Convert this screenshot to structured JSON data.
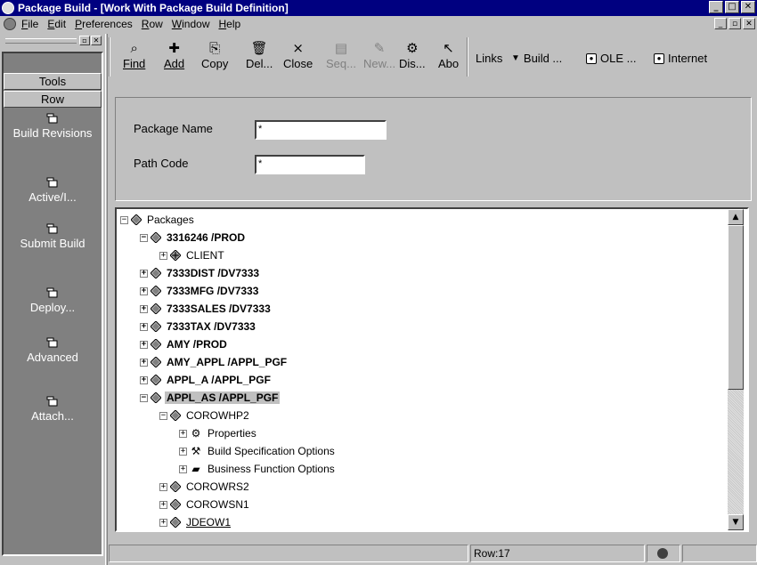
{
  "window": {
    "title": "Package Build - [Work With Package Build Definition]"
  },
  "menu": [
    {
      "label": "File",
      "u": "F",
      "rest": "ile"
    },
    {
      "label": "Edit",
      "u": "E",
      "rest": "dit"
    },
    {
      "label": "Preferences",
      "u": "P",
      "rest": "references"
    },
    {
      "label": "Row",
      "u": "R",
      "rest": "ow"
    },
    {
      "label": "Window",
      "u": "W",
      "rest": "indow"
    },
    {
      "label": "Help",
      "u": "H",
      "rest": "elp"
    }
  ],
  "sidebar": {
    "tabs": [
      "Tools",
      "Row"
    ],
    "items": [
      {
        "label": "Build Revisions"
      },
      {
        "label": "Active/I..."
      },
      {
        "label": "Submit Build"
      },
      {
        "label": "Deploy..."
      },
      {
        "label": "Advanced"
      },
      {
        "label": "Attach..."
      }
    ]
  },
  "toolbar": {
    "find": "Find",
    "add": "Add",
    "copy": "Copy",
    "delete": "Del...",
    "close": "Close",
    "seq": "Seq...",
    "new": "New...",
    "dis": "Dis...",
    "abo": "Abo",
    "links": "Links",
    "build": "Build ...",
    "ole": "OLE ...",
    "internet": "Internet"
  },
  "form": {
    "package_name_label": "Package Name",
    "package_name_value": "*",
    "path_code_label": "Path Code",
    "path_code_value": "*"
  },
  "tree": [
    {
      "label": "Packages",
      "level": 0,
      "pm": "-",
      "icon": "diamond",
      "bold": false
    },
    {
      "label": "3316246 /PROD",
      "level": 1,
      "pm": "-",
      "icon": "diamond",
      "bold": true
    },
    {
      "label": "CLIENT",
      "level": 2,
      "pm": "+",
      "icon": "diamond-cross",
      "bold": false
    },
    {
      "label": "7333DIST /DV7333",
      "level": 1,
      "pm": "+",
      "icon": "diamond",
      "bold": true
    },
    {
      "label": "7333MFG /DV7333",
      "level": 1,
      "pm": "+",
      "icon": "diamond",
      "bold": true
    },
    {
      "label": "7333SALES /DV7333",
      "level": 1,
      "pm": "+",
      "icon": "diamond",
      "bold": true
    },
    {
      "label": "7333TAX /DV7333",
      "level": 1,
      "pm": "+",
      "icon": "diamond",
      "bold": true
    },
    {
      "label": "AMY /PROD",
      "level": 1,
      "pm": "+",
      "icon": "diamond",
      "bold": true
    },
    {
      "label": "AMY_APPL /APPL_PGF",
      "level": 1,
      "pm": "+",
      "icon": "diamond",
      "bold": true
    },
    {
      "label": "APPL_A /APPL_PGF",
      "level": 1,
      "pm": "+",
      "icon": "diamond",
      "bold": true
    },
    {
      "label": "APPL_AS /APPL_PGF",
      "level": 1,
      "pm": "-",
      "icon": "diamond",
      "bold": true,
      "selected": true
    },
    {
      "label": "COROWHP2",
      "level": 2,
      "pm": "-",
      "icon": "diamond",
      "bold": false
    },
    {
      "label": "Properties",
      "level": 3,
      "pm": "+",
      "icon": "properties",
      "bold": false
    },
    {
      "label": "Build Specification Options",
      "level": 3,
      "pm": "+",
      "icon": "hammer",
      "bold": false
    },
    {
      "label": "Business Function Options",
      "level": 3,
      "pm": "+",
      "icon": "briefcase",
      "bold": false
    },
    {
      "label": "COROWRS2",
      "level": 2,
      "pm": "+",
      "icon": "diamond",
      "bold": false
    },
    {
      "label": "COROWSN1",
      "level": 2,
      "pm": "+",
      "icon": "diamond",
      "bold": false
    },
    {
      "label": "JDEOW1",
      "level": 2,
      "pm": "+",
      "icon": "diamond",
      "bold": false,
      "link": true
    }
  ],
  "status": {
    "row": "Row:17"
  }
}
